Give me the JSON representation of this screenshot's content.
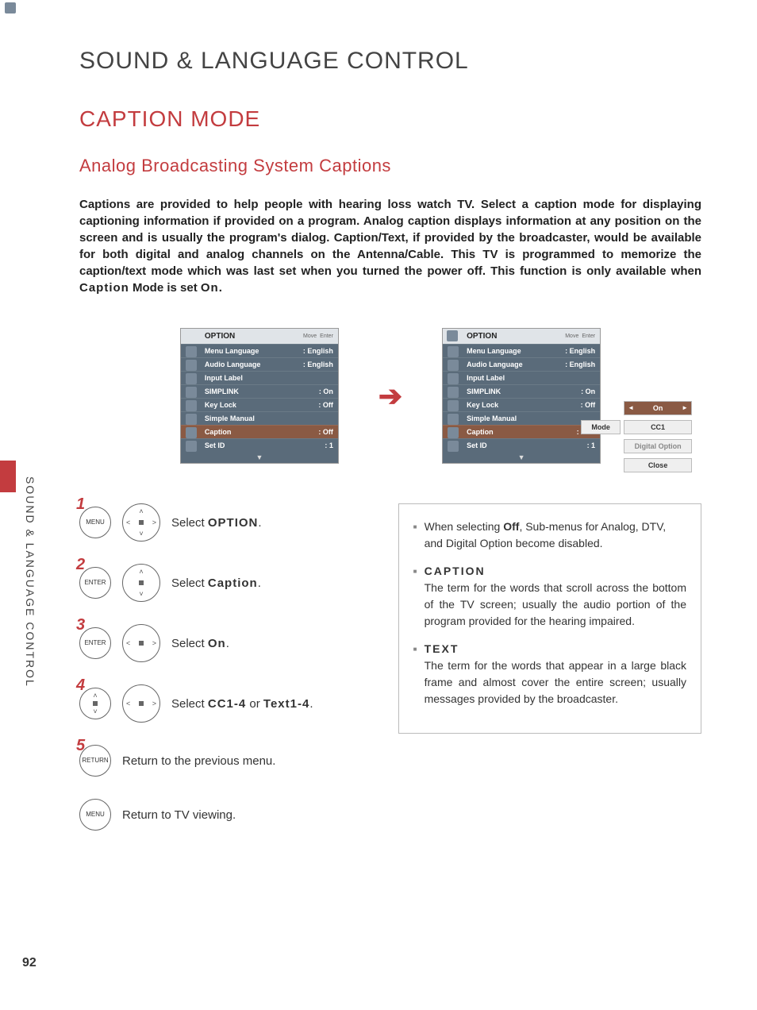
{
  "page_number": "92",
  "side_label": "SOUND & LANGUAGE CONTROL",
  "main_title": "SOUND & LANGUAGE CONTROL",
  "section_title": "CAPTION MODE",
  "sub_title": "Analog Broadcasting System Captions",
  "intro": {
    "pre": "Captions are provided to help people with hearing loss watch TV. Select a caption mode for displaying captioning information if provided on a program. Analog caption displays information at any position on the screen and is usually the program's dialog. Caption/Text, if provided by the broadcaster, would be available for both digital and analog channels on the Antenna/Cable. This TV is programmed to memorize the caption/text mode which was last set when you turned the power off. This function is only available when ",
    "b1": "Caption",
    "mid": " Mode is set ",
    "b2": "On",
    "post": "."
  },
  "osd": {
    "title": "OPTION",
    "hint_move": "Move",
    "hint_enter": "Enter",
    "rows": [
      {
        "label": "Menu Language",
        "value": ": English"
      },
      {
        "label": "Audio Language",
        "value": ": English"
      },
      {
        "label": "Input Label",
        "value": ""
      },
      {
        "label": "SIMPLINK",
        "value": ": On"
      },
      {
        "label": "Key Lock",
        "value": ": Off"
      },
      {
        "label": "Simple Manual",
        "value": ""
      },
      {
        "label": "Caption",
        "value_a": ": Off",
        "value_b": ": CC1"
      },
      {
        "label": "Set ID",
        "value": ": 1"
      }
    ]
  },
  "submenu": {
    "on_label": "On",
    "mode_label": "Mode",
    "mode_value": "CC1",
    "digital": "Digital Option",
    "close": "Close"
  },
  "steps": [
    {
      "num": "1",
      "btn": "MENU",
      "pad": "full",
      "text_pre": "Select ",
      "text_b": "OPTION",
      "text_post": "."
    },
    {
      "num": "2",
      "btn": "ENTER",
      "pad": "ud",
      "text_pre": "Select ",
      "text_b": "Caption",
      "text_post": "."
    },
    {
      "num": "3",
      "btn": "ENTER",
      "pad": "lr",
      "text_pre": "Select ",
      "text_b": "On",
      "text_post": "."
    },
    {
      "num": "4",
      "btn": "",
      "pad": "udlr",
      "text_pre": "Select ",
      "text_b": "CC1-4",
      "text_mid": " or ",
      "text_b2": "Text1-4",
      "text_post": "."
    },
    {
      "num": "5",
      "btn": "RETURN",
      "pad": "",
      "text_pre": "Return to the previous menu.",
      "text_b": "",
      "text_post": ""
    },
    {
      "num": "",
      "btn": "MENU",
      "pad": "",
      "text_pre": "Return to TV viewing.",
      "text_b": "",
      "text_post": ""
    }
  ],
  "info": {
    "off_pre": "When selecting ",
    "off_b": "Off",
    "off_post": ", Sub-menus for Analog, DTV, and Digital Option become disabled.",
    "caption_term": "CAPTION",
    "caption_desc": "The term for the words that scroll across the bottom of the TV screen; usually the audio portion of the program provided for the hearing impaired.",
    "text_term": "TEXT",
    "text_desc": "The term for the words that appear in a large black frame and almost cover the entire screen; usually messages provided by the broadcaster."
  }
}
